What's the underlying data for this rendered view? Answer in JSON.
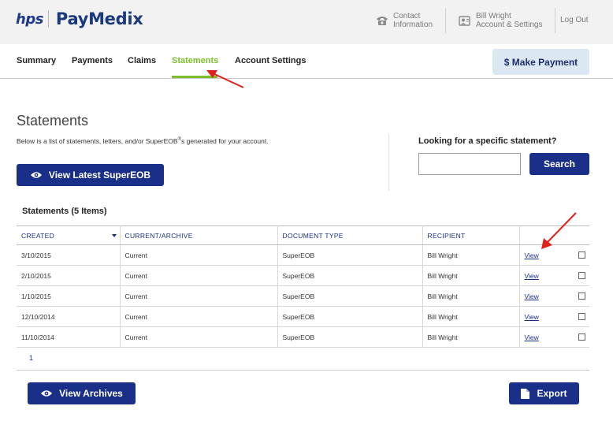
{
  "header": {
    "logo_prefix": "hps",
    "logo_name": "PayMedix",
    "contact_line1": "Contact",
    "contact_line2": "Information",
    "user_line1": "Bill Wright",
    "user_line2": "Account & Settings",
    "logout": "Log Out"
  },
  "nav": {
    "items": [
      {
        "label": "Summary"
      },
      {
        "label": "Payments"
      },
      {
        "label": "Claims"
      },
      {
        "label": "Statements"
      },
      {
        "label": "Account Settings"
      }
    ],
    "make_payment": "$ Make Payment"
  },
  "page": {
    "title": "Statements",
    "description_before": "Below is a list of statements, letters, and/or SuperEOB",
    "description_sup": "®",
    "description_after": "s generated for your account.",
    "view_latest": "View Latest SuperEOB",
    "search_label": "Looking for a specific statement?",
    "search_value": "",
    "search_button": "Search",
    "list_title": "Statements (5 Items)",
    "view_archives": "View Archives",
    "export": "Export",
    "pager_current": "1"
  },
  "table": {
    "columns": [
      "CREATED",
      "CURRENT/ARCHIVE",
      "DOCUMENT TYPE",
      "RECIPIENT",
      ""
    ],
    "rows": [
      {
        "created": "3/10/2015",
        "status": "Current",
        "doc_type": "SuperEOB",
        "recipient": "Bill Wright",
        "action": "View"
      },
      {
        "created": "2/10/2015",
        "status": "Current",
        "doc_type": "SuperEOB",
        "recipient": "Bill Wright",
        "action": "View"
      },
      {
        "created": "1/10/2015",
        "status": "Current",
        "doc_type": "SuperEOB",
        "recipient": "Bill Wright",
        "action": "View"
      },
      {
        "created": "12/10/2014",
        "status": "Current",
        "doc_type": "SuperEOB",
        "recipient": "Bill Wright",
        "action": "View"
      },
      {
        "created": "11/10/2014",
        "status": "Current",
        "doc_type": "SuperEOB",
        "recipient": "Bill Wright",
        "action": "View"
      }
    ]
  },
  "colors": {
    "brand_blue": "#1a2f87",
    "active_green": "#7cbf2a",
    "annotation_red": "#e0201b"
  },
  "icons": {
    "contact": "phone-icon",
    "user": "user-card-icon",
    "view": "eye-icon",
    "export": "document-icon",
    "sort": "caret-down-icon"
  }
}
